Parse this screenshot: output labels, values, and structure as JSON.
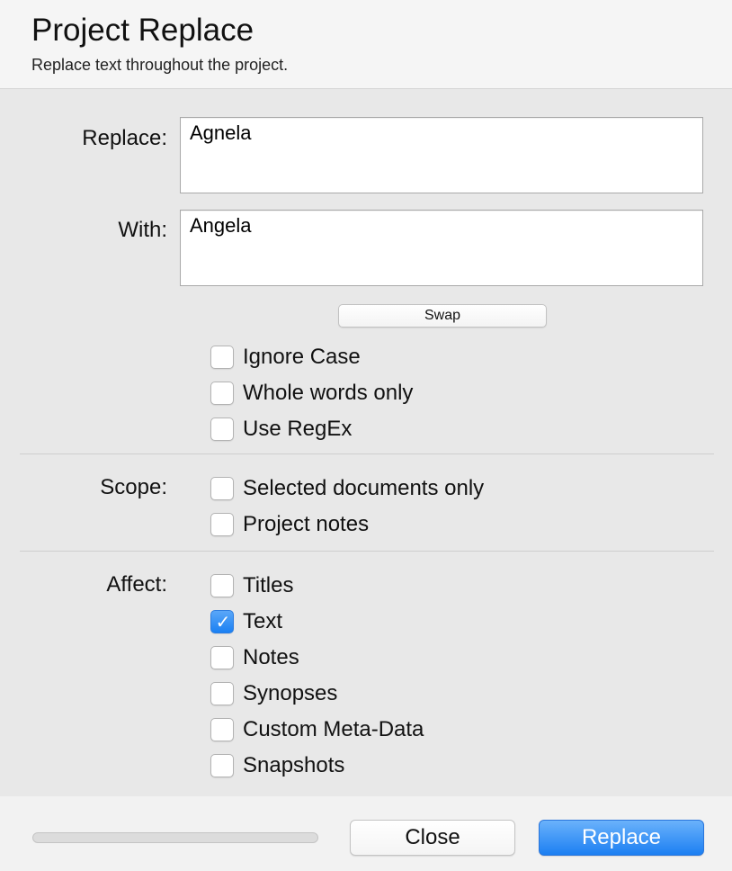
{
  "header": {
    "title": "Project Replace",
    "subtitle": "Replace text throughout the project."
  },
  "replace": {
    "label": "Replace:",
    "value": "Agnela"
  },
  "with": {
    "label": "With:",
    "value": "Angela"
  },
  "swap_label": "Swap",
  "options": [
    {
      "label": "Ignore Case",
      "checked": false
    },
    {
      "label": "Whole words only",
      "checked": false
    },
    {
      "label": "Use RegEx",
      "checked": false
    }
  ],
  "scope": {
    "label": "Scope:",
    "items": [
      {
        "label": "Selected documents only",
        "checked": false
      },
      {
        "label": "Project notes",
        "checked": false
      }
    ]
  },
  "affect": {
    "label": "Affect:",
    "items": [
      {
        "label": "Titles",
        "checked": false
      },
      {
        "label": "Text",
        "checked": true
      },
      {
        "label": "Notes",
        "checked": false
      },
      {
        "label": "Synopses",
        "checked": false
      },
      {
        "label": "Custom Meta-Data",
        "checked": false
      },
      {
        "label": "Snapshots",
        "checked": false
      }
    ]
  },
  "progress": 0,
  "buttons": {
    "close": "Close",
    "replace": "Replace"
  },
  "colors": {
    "accent": "#1c7ff2",
    "checkbox_checked": "#1a80f3"
  },
  "icons": {
    "checkmark": "✓"
  }
}
